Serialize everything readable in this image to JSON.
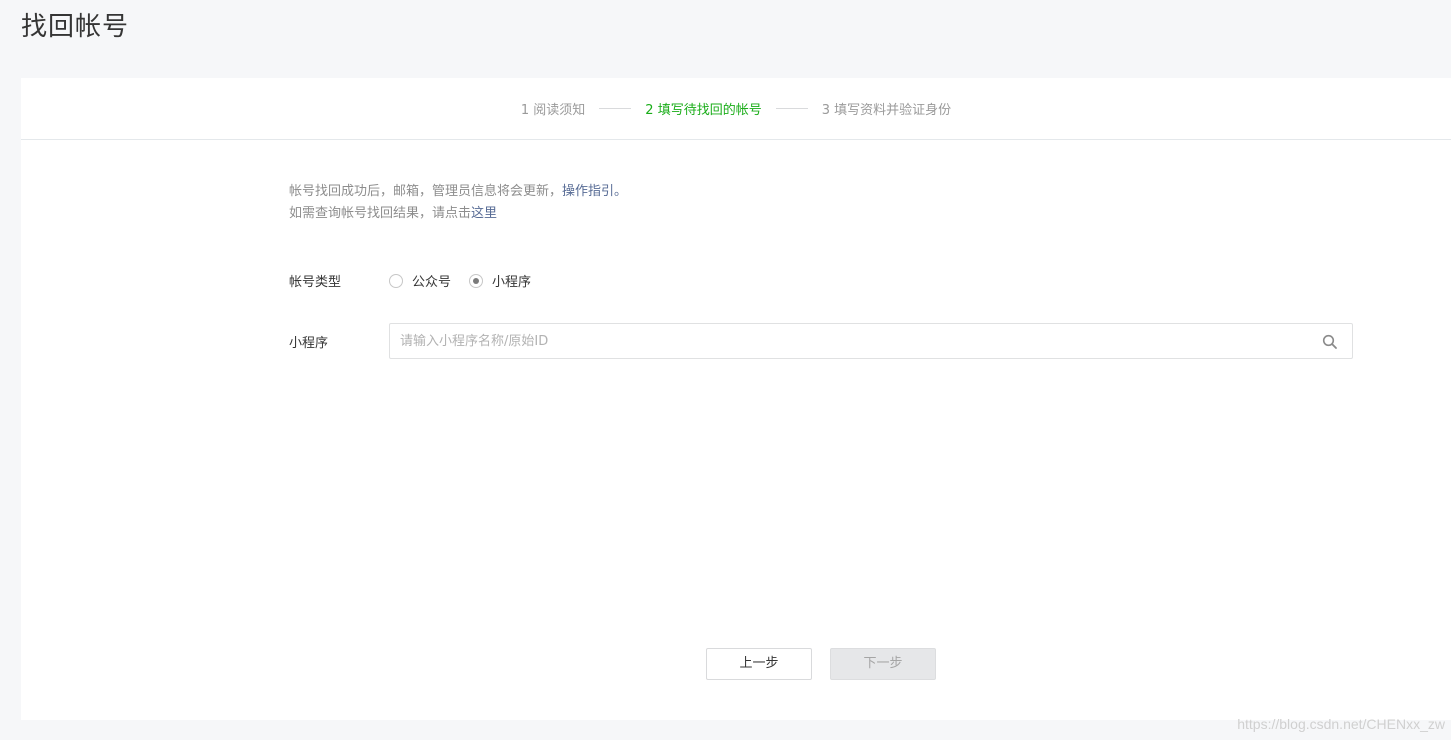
{
  "page": {
    "title": "找回帐号"
  },
  "steps": [
    {
      "label": "1 阅读须知",
      "active": false
    },
    {
      "label": "2 填写待找回的帐号",
      "active": true
    },
    {
      "label": "3 填写资料并验证身份",
      "active": false
    }
  ],
  "tips": {
    "line1_text": "帐号找回成功后，邮箱，管理员信息将会更新，",
    "line1_link": "操作指引。",
    "line2_text": "如需查询帐号找回结果，请点击",
    "line2_link": "这里"
  },
  "form": {
    "account_type_label": "帐号类型",
    "options": [
      {
        "label": "公众号",
        "checked": false
      },
      {
        "label": "小程序",
        "checked": true
      }
    ],
    "mini_program_label": "小程序",
    "search_placeholder": "请输入小程序名称/原始ID",
    "search_value": ""
  },
  "buttons": {
    "prev": "上一步",
    "next": "下一步"
  },
  "watermark": "https://blog.csdn.net/CHENxx_zw",
  "colors": {
    "accent": "#1aad19",
    "link": "#576b95",
    "background": "#f6f7f9"
  },
  "icons": {
    "search": "search-icon"
  }
}
